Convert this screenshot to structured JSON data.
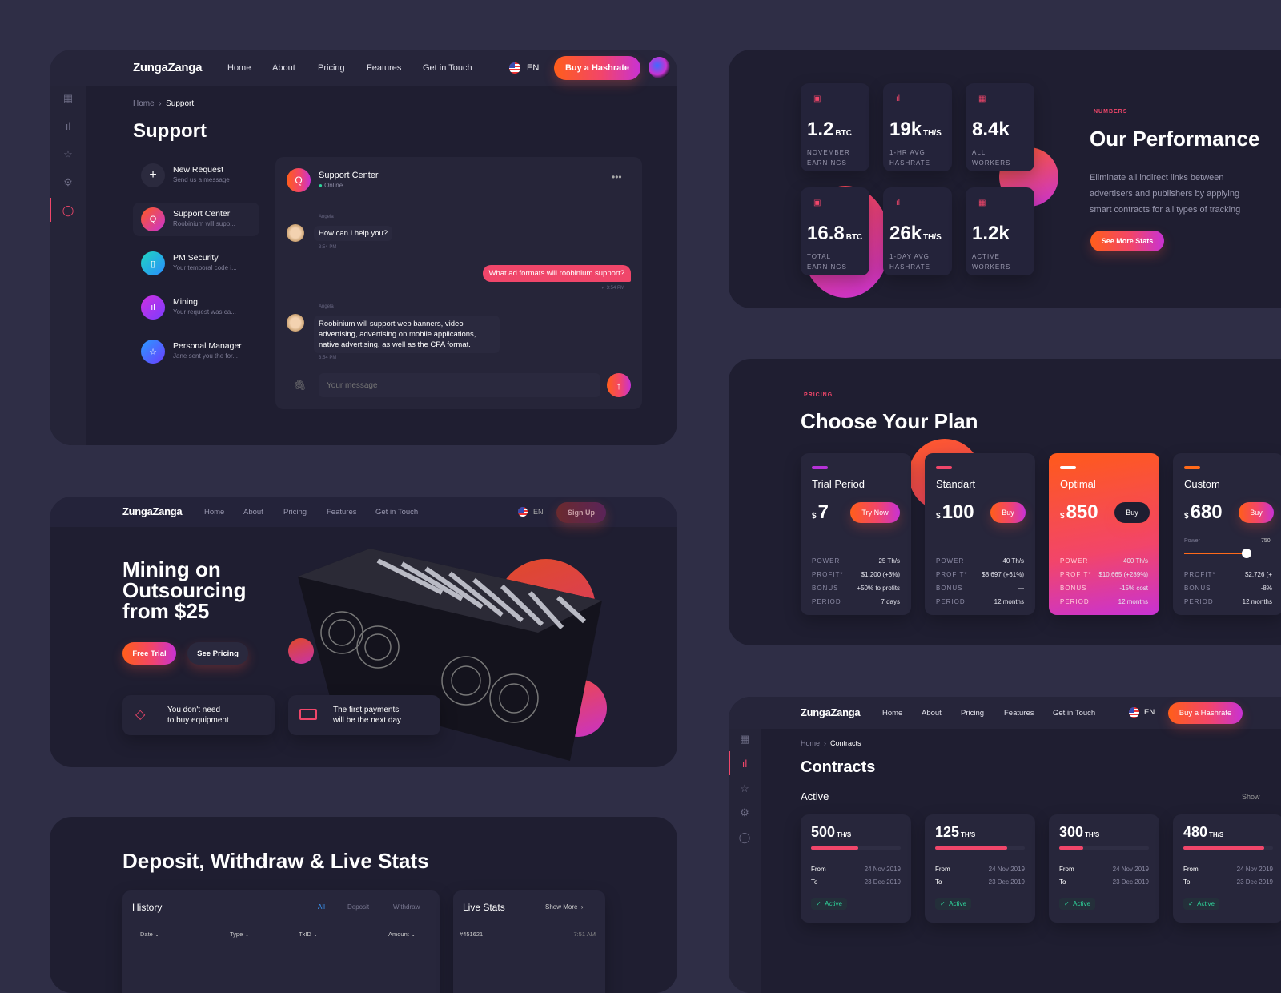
{
  "colors": {
    "accent_orange": "#ff5e1a",
    "accent_pink": "#f0466a",
    "accent_purple": "#c832d4",
    "online": "#2fd39a",
    "panel": "#1f1e31",
    "background": "#2f2e46"
  },
  "brand": "ZungaZanga",
  "nav": [
    "Home",
    "About",
    "Pricing",
    "Features",
    "Get in Touch"
  ],
  "language": "EN",
  "support": {
    "buy_button": "Buy a Hashrate",
    "sidebar_icons": [
      "grid-icon",
      "chart-icon",
      "star-icon",
      "gear-icon",
      "chat-icon"
    ],
    "breadcrumb": {
      "home": "Home",
      "current": "Support"
    },
    "title": "Support",
    "requests": [
      {
        "title": "New Request",
        "sub": "Send us a message",
        "icon": "plus-icon",
        "glyph": "+"
      },
      {
        "title": "Support Center",
        "sub": "Roobinium will supp...",
        "icon": "chat-icon",
        "glyph": "Q"
      },
      {
        "title": "PM Security",
        "sub": "Your temporal code i...",
        "icon": "bookmark-icon",
        "glyph": "▯"
      },
      {
        "title": "Mining",
        "sub": "Your request was ca...",
        "icon": "chart-icon",
        "glyph": "ıl"
      },
      {
        "title": "Personal Manager",
        "sub": "Jane sent you the for...",
        "icon": "star-icon",
        "glyph": "☆"
      }
    ],
    "chat": {
      "title": "Support Center",
      "status": "Online",
      "messages": [
        {
          "author": "Angela",
          "text": "How can I help you?",
          "time": "3:54 PM"
        },
        {
          "text": "What ad formats will roobinium support?",
          "time": "3:54 PM"
        },
        {
          "author": "Angela",
          "text": "Roobinium will support web banners, video advertising, advertising on mobile applications, native advertising, as well as the CPA format.",
          "time": "3:54 PM"
        }
      ],
      "placeholder": "Your message"
    }
  },
  "hero": {
    "signup": "Sign Up",
    "headline": [
      "Mining on",
      "Outsourcing",
      "from $25"
    ],
    "free_trial": "Free Trial",
    "see_pricing": "See Pricing",
    "features": [
      {
        "line1": "You don't need",
        "line2": "to buy equipment",
        "icon": "tag-icon"
      },
      {
        "line1": "The first payments",
        "line2": "will be the next day",
        "icon": "cash-icon"
      }
    ]
  },
  "deposit": {
    "title": "Deposit, Withdraw & Live Stats",
    "history": {
      "title": "History",
      "filters": [
        "All",
        "Deposit",
        "Withdraw"
      ],
      "columns": [
        "Date",
        "Type",
        "TxID",
        "Amount"
      ]
    },
    "live": {
      "title": "Live Stats",
      "show_more": "Show More",
      "rows": [
        {
          "id": "#451621",
          "time": "7:51 AM"
        }
      ]
    }
  },
  "performance": {
    "stats": [
      {
        "value": "1.2",
        "unit": "BTC",
        "label": [
          "NOVEMBER",
          "EARNINGS"
        ],
        "icon": "wallet-icon"
      },
      {
        "value": "19k",
        "unit": "TH/S",
        "label": [
          "1-HR AVG",
          "HASHRATE"
        ],
        "icon": "chart-icon"
      },
      {
        "value": "8.4k",
        "unit": "",
        "label": [
          "ALL",
          "WORKERS"
        ],
        "icon": "grid-icon"
      },
      {
        "value": "16.8",
        "unit": "BTC",
        "label": [
          "TOTAL",
          "EARNINGS"
        ],
        "icon": "wallet-icon"
      },
      {
        "value": "26k",
        "unit": "TH/S",
        "label": [
          "1-DAY AVG",
          "HASHRATE"
        ],
        "icon": "chart-icon"
      },
      {
        "value": "1.2k",
        "unit": "",
        "label": [
          "ACTIVE",
          "WORKERS"
        ],
        "icon": "grid-icon"
      }
    ],
    "eyebrow": "NUMBERS",
    "title": "Our Performance",
    "text": [
      "Eliminate all indirect links between",
      "advertisers and publishers by applying",
      "smart contracts for all types of tracking"
    ],
    "button": "See More Stats"
  },
  "pricing": {
    "eyebrow": "PRICING",
    "title": "Choose Your Plan",
    "plans": [
      {
        "name": "Trial Period",
        "currency": "$",
        "price": "7",
        "button": "Try Now",
        "bar": "#b632d8",
        "rows": [
          [
            "POWER",
            "25 Th/s"
          ],
          [
            "PROFIT*",
            "$1,200 (+3%)"
          ],
          [
            "BONUS",
            "+50% to profits"
          ],
          [
            "PERIOD",
            "7 days"
          ]
        ]
      },
      {
        "name": "Standart",
        "currency": "$",
        "price": "100",
        "button": "Buy",
        "bar": "#f0466a",
        "rows": [
          [
            "POWER",
            "40 Th/s"
          ],
          [
            "PROFIT*",
            "$8,697 (+61%)"
          ],
          [
            "BONUS",
            "—"
          ],
          [
            "PERIOD",
            "12 months"
          ]
        ]
      },
      {
        "name": "Optimal",
        "currency": "$",
        "price": "850",
        "button": "Buy",
        "bar": "#ffffff",
        "highlighted": true,
        "rows": [
          [
            "POWER",
            "400 Th/s"
          ],
          [
            "PROFIT*",
            "$10,665 (+289%)"
          ],
          [
            "BONUS",
            "-15% cost"
          ],
          [
            "PERIOD",
            "12 months"
          ]
        ]
      },
      {
        "name": "Custom",
        "currency": "$",
        "price": "680",
        "button": "Buy",
        "bar": "#ff6a1a",
        "slider": {
          "label": "Power",
          "value": "750",
          "level": 0.85
        },
        "rows": [
          [
            "PROFIT*",
            "$2,726 (+"
          ],
          [
            "BONUS",
            "-8%"
          ],
          [
            "PERIOD",
            "12 months"
          ]
        ]
      }
    ]
  },
  "contracts": {
    "buy_button": "Buy a Hashrate",
    "breadcrumb": {
      "home": "Home",
      "current": "Contracts"
    },
    "title": "Contracts",
    "section": "Active",
    "show": "Show",
    "items": [
      {
        "value": "500",
        "unit": "TH/S",
        "progress": 0.53,
        "from": "24 Nov 2019",
        "to": "23 Dec 2019",
        "status": "Active"
      },
      {
        "value": "125",
        "unit": "TH/S",
        "progress": 0.8,
        "from": "24 Nov 2019",
        "to": "23 Dec 2019",
        "status": "Active"
      },
      {
        "value": "300",
        "unit": "TH/S",
        "progress": 0.27,
        "from": "24 Nov 2019",
        "to": "23 Dec 2019",
        "status": "Active"
      },
      {
        "value": "480",
        "unit": "TH/S",
        "progress": 0.9,
        "from": "24 Nov 2019",
        "to": "23 Dec 2019",
        "status": "Active"
      }
    ],
    "labels": {
      "from": "From",
      "to": "To"
    }
  }
}
